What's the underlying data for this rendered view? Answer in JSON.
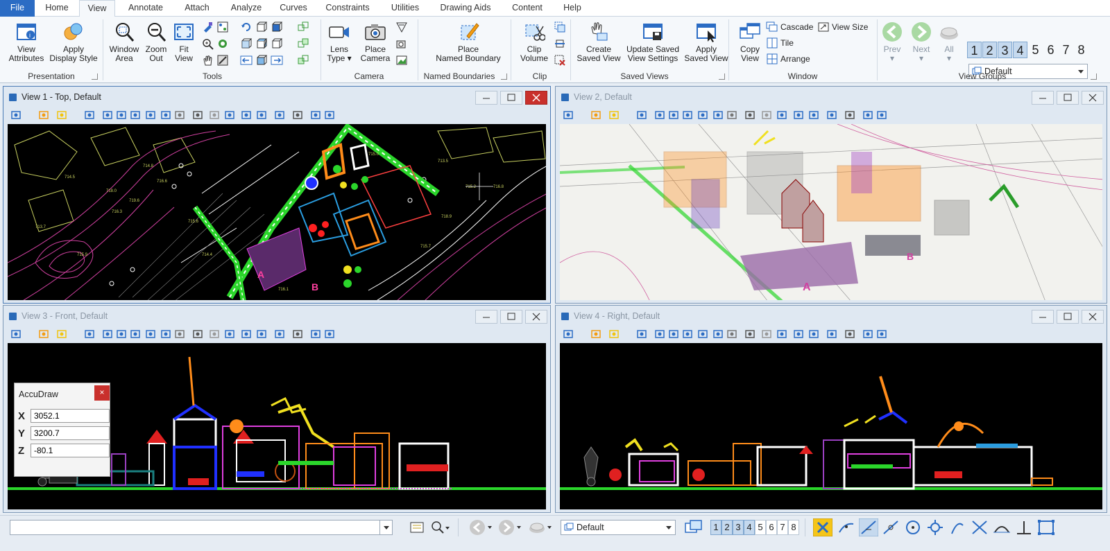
{
  "tabs": [
    "File",
    "Home",
    "View",
    "Annotate",
    "Attach",
    "Analyze",
    "Curves",
    "Constraints",
    "Utilities",
    "Drawing Aids",
    "Content",
    "Help"
  ],
  "ribbon": {
    "presentation": {
      "label": "Presentation",
      "view_attributes": [
        "View",
        "Attributes"
      ],
      "apply_display_style": [
        "Apply",
        "Display Style"
      ]
    },
    "tools": {
      "label": "Tools",
      "window_area": [
        "Window",
        "Area"
      ],
      "zoom_out": [
        "Zoom",
        "Out"
      ],
      "fit_view": [
        "Fit",
        "View"
      ]
    },
    "camera": {
      "label": "Camera",
      "lens_type": [
        "Lens",
        "Type"
      ],
      "place_camera": [
        "Place",
        "Camera"
      ]
    },
    "named_boundaries": {
      "label": "Named Boundaries",
      "place": [
        "Place",
        "Named Boundary"
      ]
    },
    "clip": {
      "label": "Clip",
      "clip_volume": [
        "Clip",
        "Volume"
      ]
    },
    "saved_views": {
      "label": "Saved Views",
      "create": [
        "Create",
        "Saved View"
      ],
      "update": [
        "Update Saved",
        "View Settings"
      ],
      "apply": [
        "Apply",
        "Saved View"
      ]
    },
    "window": {
      "label": "Window",
      "copy_view": [
        "Copy",
        "View"
      ],
      "cascade": "Cascade",
      "tile": "Tile",
      "arrange": "Arrange",
      "view_size": "View Size"
    },
    "view_groups": {
      "label": "View Groups",
      "prev": "Prev",
      "next": "Next",
      "all": "All",
      "numbers": [
        "1",
        "2",
        "3",
        "4",
        "5",
        "6",
        "7",
        "8"
      ],
      "selected_numbers": [
        "1",
        "2",
        "3",
        "4"
      ],
      "group": "Default"
    }
  },
  "views": [
    {
      "title": "View 1 - Top, Default",
      "active": true
    },
    {
      "title": "View 2, Default",
      "active": false
    },
    {
      "title": "View 3 - Front, Default",
      "active": false
    },
    {
      "title": "View 4 - Right, Default",
      "active": false
    }
  ],
  "accudraw": {
    "title": "AccuDraw",
    "close": "×",
    "x_label": "X",
    "x": "3052.1",
    "y_label": "Y",
    "y": "3200.7",
    "z_label": "Z",
    "z": "-80.1"
  },
  "top_labels": [
    "714.8",
    "716.6",
    "718.0",
    "719.6",
    "715.6",
    "714.4",
    "716.1",
    "713.5",
    "715.2",
    "716.8",
    "715.7",
    "718.9",
    "716.3",
    "715.0",
    "713.7",
    "714.5",
    "715.9"
  ],
  "site_labels": {
    "a": "A",
    "b": "B"
  },
  "status": {
    "command": "",
    "view_group": "Default",
    "numbers": [
      "1",
      "2",
      "3",
      "4",
      "5",
      "6",
      "7",
      "8"
    ],
    "selected_numbers": [
      "1",
      "2",
      "3",
      "4"
    ]
  },
  "colors": {
    "accent": "#2b6cc4",
    "close": "#c9302c",
    "green": "#2bd62b",
    "magenta": "#e040e0",
    "yellow": "#f0e020",
    "orange": "#ff8c1a"
  }
}
